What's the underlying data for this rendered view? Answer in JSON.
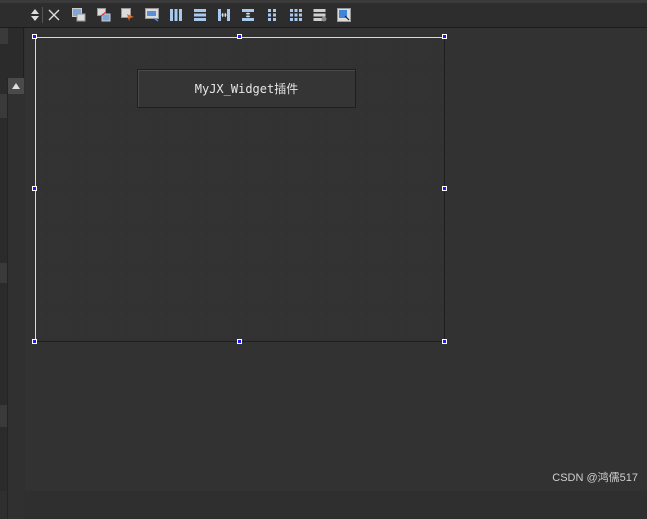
{
  "toolbar": {
    "icons": [
      "sort-updown-icon",
      "close-icon",
      "edit-widgets-icon",
      "edit-signals-slots-icon",
      "edit-buddies-icon",
      "edit-tab-order-icon",
      "layout-horizontal-icon",
      "layout-vertical-icon",
      "layout-horizontal-splitter-icon",
      "layout-vertical-splitter-icon",
      "layout-form-icon",
      "layout-grid-icon",
      "break-layout-icon",
      "adjust-size-icon"
    ],
    "accent": "#5aa0ff"
  },
  "form": {
    "selection_handle_color": "#1a1aff",
    "widget_button_label": "MyJX_Widget插件"
  },
  "watermark": "CSDN @鸿儒517"
}
